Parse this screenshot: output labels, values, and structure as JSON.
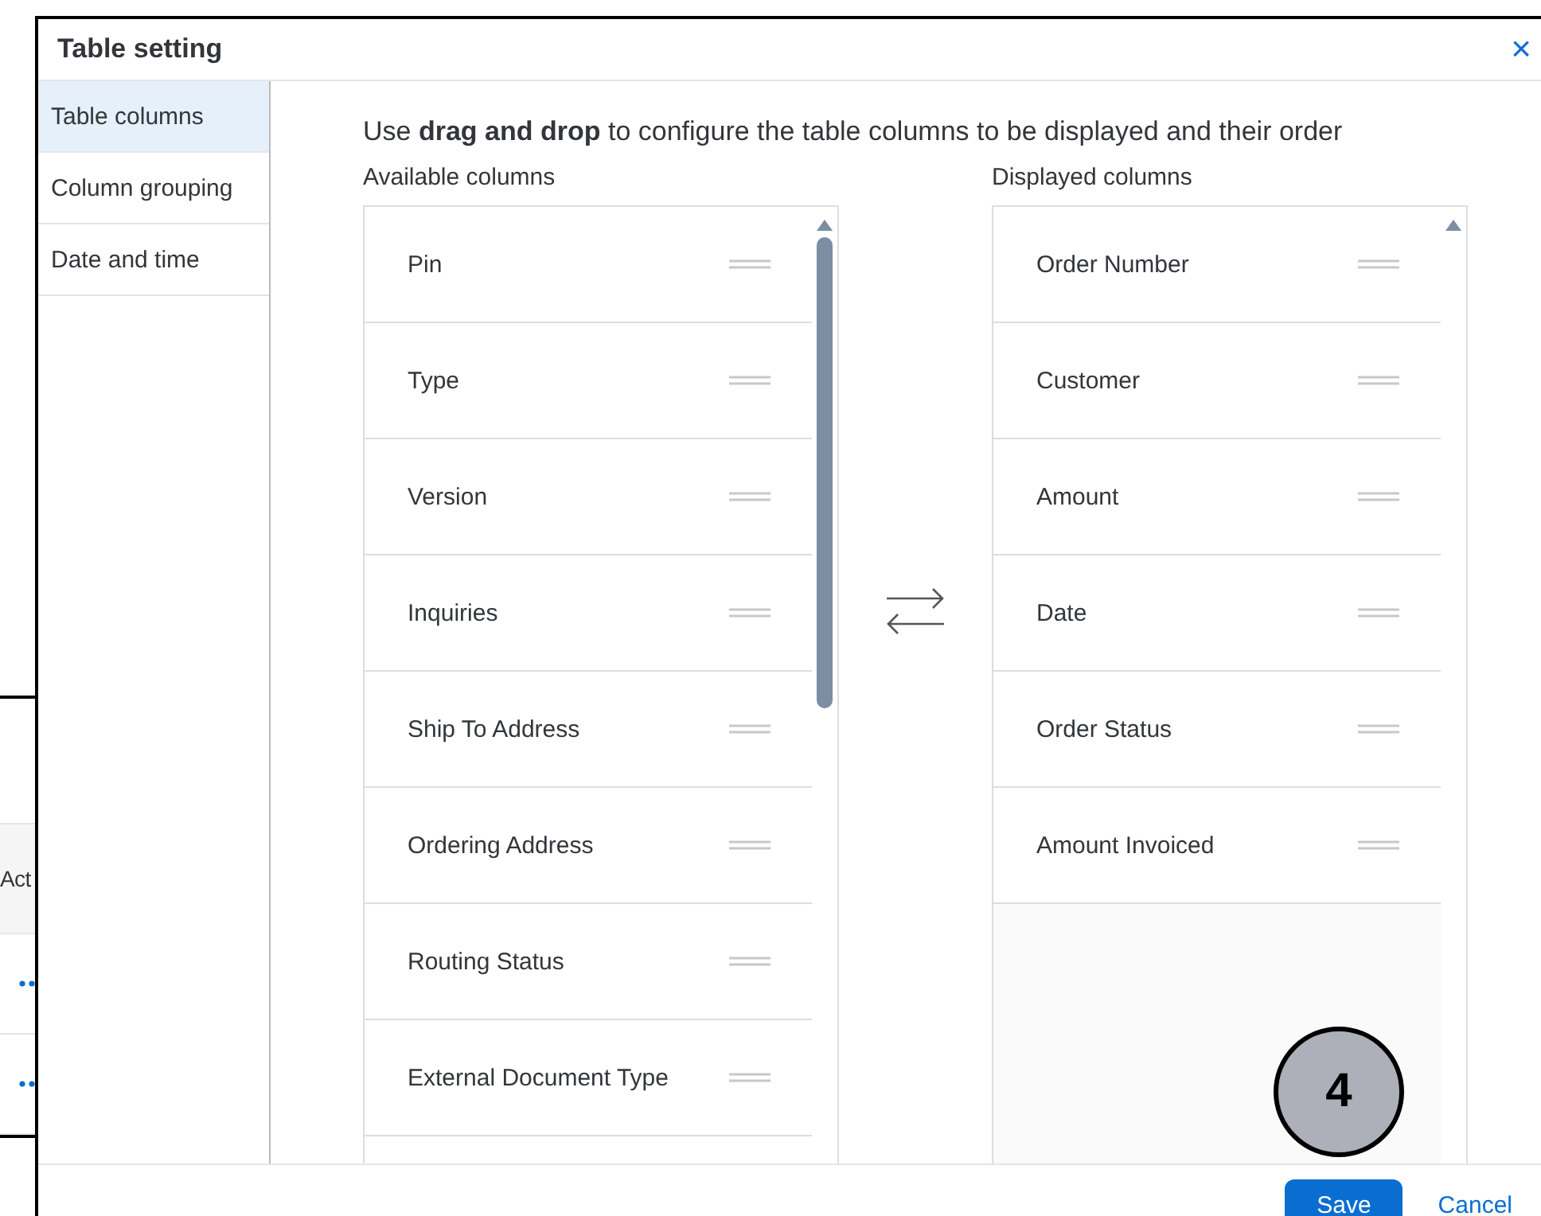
{
  "background_table": {
    "header": "Act",
    "rows": [
      {
        "kind": "more"
      },
      {
        "kind": "more"
      }
    ]
  },
  "dialog": {
    "title": "Table setting",
    "close": "×"
  },
  "sidebar": {
    "items": [
      {
        "label": "Table columns",
        "selected": true
      },
      {
        "label": "Column grouping",
        "selected": false
      },
      {
        "label": "Date and time",
        "selected": false
      }
    ]
  },
  "instruction": "Use **drag and drop** to configure the table columns to be displayed and their order",
  "available": {
    "label": "Available columns",
    "items": [
      "Pin",
      "Type",
      "Version",
      "Inquiries",
      "Ship To Address",
      "Ordering Address",
      "Routing Status",
      "External Document Type"
    ]
  },
  "displayed": {
    "label": "Displayed columns",
    "items": [
      "Order Number",
      "Customer",
      "Amount",
      "Date",
      "Order Status",
      "Amount Invoiced"
    ]
  },
  "footer": {
    "buttons": [
      {
        "label": "Save",
        "kind": "primary"
      },
      {
        "label": "Cancel",
        "kind": "text"
      }
    ]
  },
  "callout": {
    "number": "4"
  }
}
